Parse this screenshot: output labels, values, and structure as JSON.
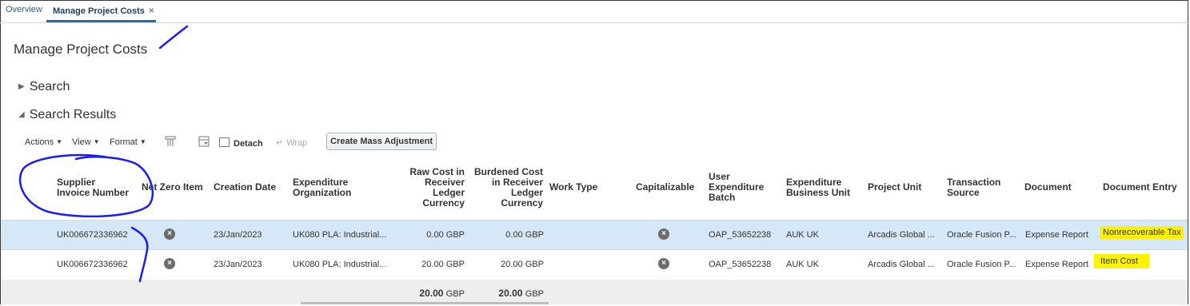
{
  "tabs": [
    {
      "label": "Overview"
    },
    {
      "label": "Manage Project Costs",
      "close": "×"
    }
  ],
  "page": {
    "title": "Manage Project Costs"
  },
  "sections": {
    "search": "Search",
    "results": "Search Results"
  },
  "toolbar": {
    "actions": "Actions",
    "view": "View",
    "format": "Format",
    "detach": "Detach",
    "wrap": "Wrap",
    "mass_adjustment": "Create Mass Adjustment"
  },
  "columns": {
    "supplier_invoice": [
      "Supplier",
      "Invoice Number"
    ],
    "net_zero": "Net Zero Item",
    "creation_date": "Creation Date",
    "exp_org": [
      "Expenditure",
      "Organization"
    ],
    "raw_cost": [
      "Raw Cost in",
      "Receiver",
      "Ledger",
      "Currency"
    ],
    "burdened_cost": [
      "Burdened Cost",
      "in Receiver",
      "Ledger",
      "Currency"
    ],
    "work_type": "Work Type",
    "capitalizable": "Capitalizable",
    "user_batch": [
      "User",
      "Expenditure",
      "Batch"
    ],
    "exp_bu": [
      "Expenditure",
      "Business Unit"
    ],
    "project_unit": "Project Unit",
    "transaction_source": [
      "Transaction",
      "Source"
    ],
    "document": "Document",
    "document_entry": "Document Entry"
  },
  "rows": [
    {
      "supplier_invoice": "UK006672336962",
      "creation_date": "23/Jan/2023",
      "exp_org": "UK080 PLA: Industrial...",
      "raw_cost": "0.00 GBP",
      "burdened_cost": "0.00 GBP",
      "user_batch": "OAP_53652238",
      "exp_bu": "AUK UK",
      "project_unit": "Arcadis Global ...",
      "transaction_source": "Oracle Fusion P...",
      "document": "Expense Report",
      "document_entry": "Nonrecoverable Tax"
    },
    {
      "supplier_invoice": "UK006672336962",
      "creation_date": "23/Jan/2023",
      "exp_org": "UK080 PLA: Industrial...",
      "raw_cost": "20.00 GBP",
      "burdened_cost": "20.00 GBP",
      "user_batch": "OAP_53652238",
      "exp_bu": "AUK UK",
      "project_unit": "Arcadis Global ...",
      "transaction_source": "Oracle Fusion P...",
      "document": "Expense Report",
      "document_entry": "Item Cost"
    }
  ],
  "totals": {
    "raw_cost_value": "20.00",
    "raw_cost_unit": "GBP",
    "burdened_cost_value": "20.00",
    "burdened_cost_unit": "GBP"
  },
  "colors": {
    "highlight": "#fff200",
    "ink": "#1a1aff",
    "selected_row": "#d6e7f7"
  }
}
